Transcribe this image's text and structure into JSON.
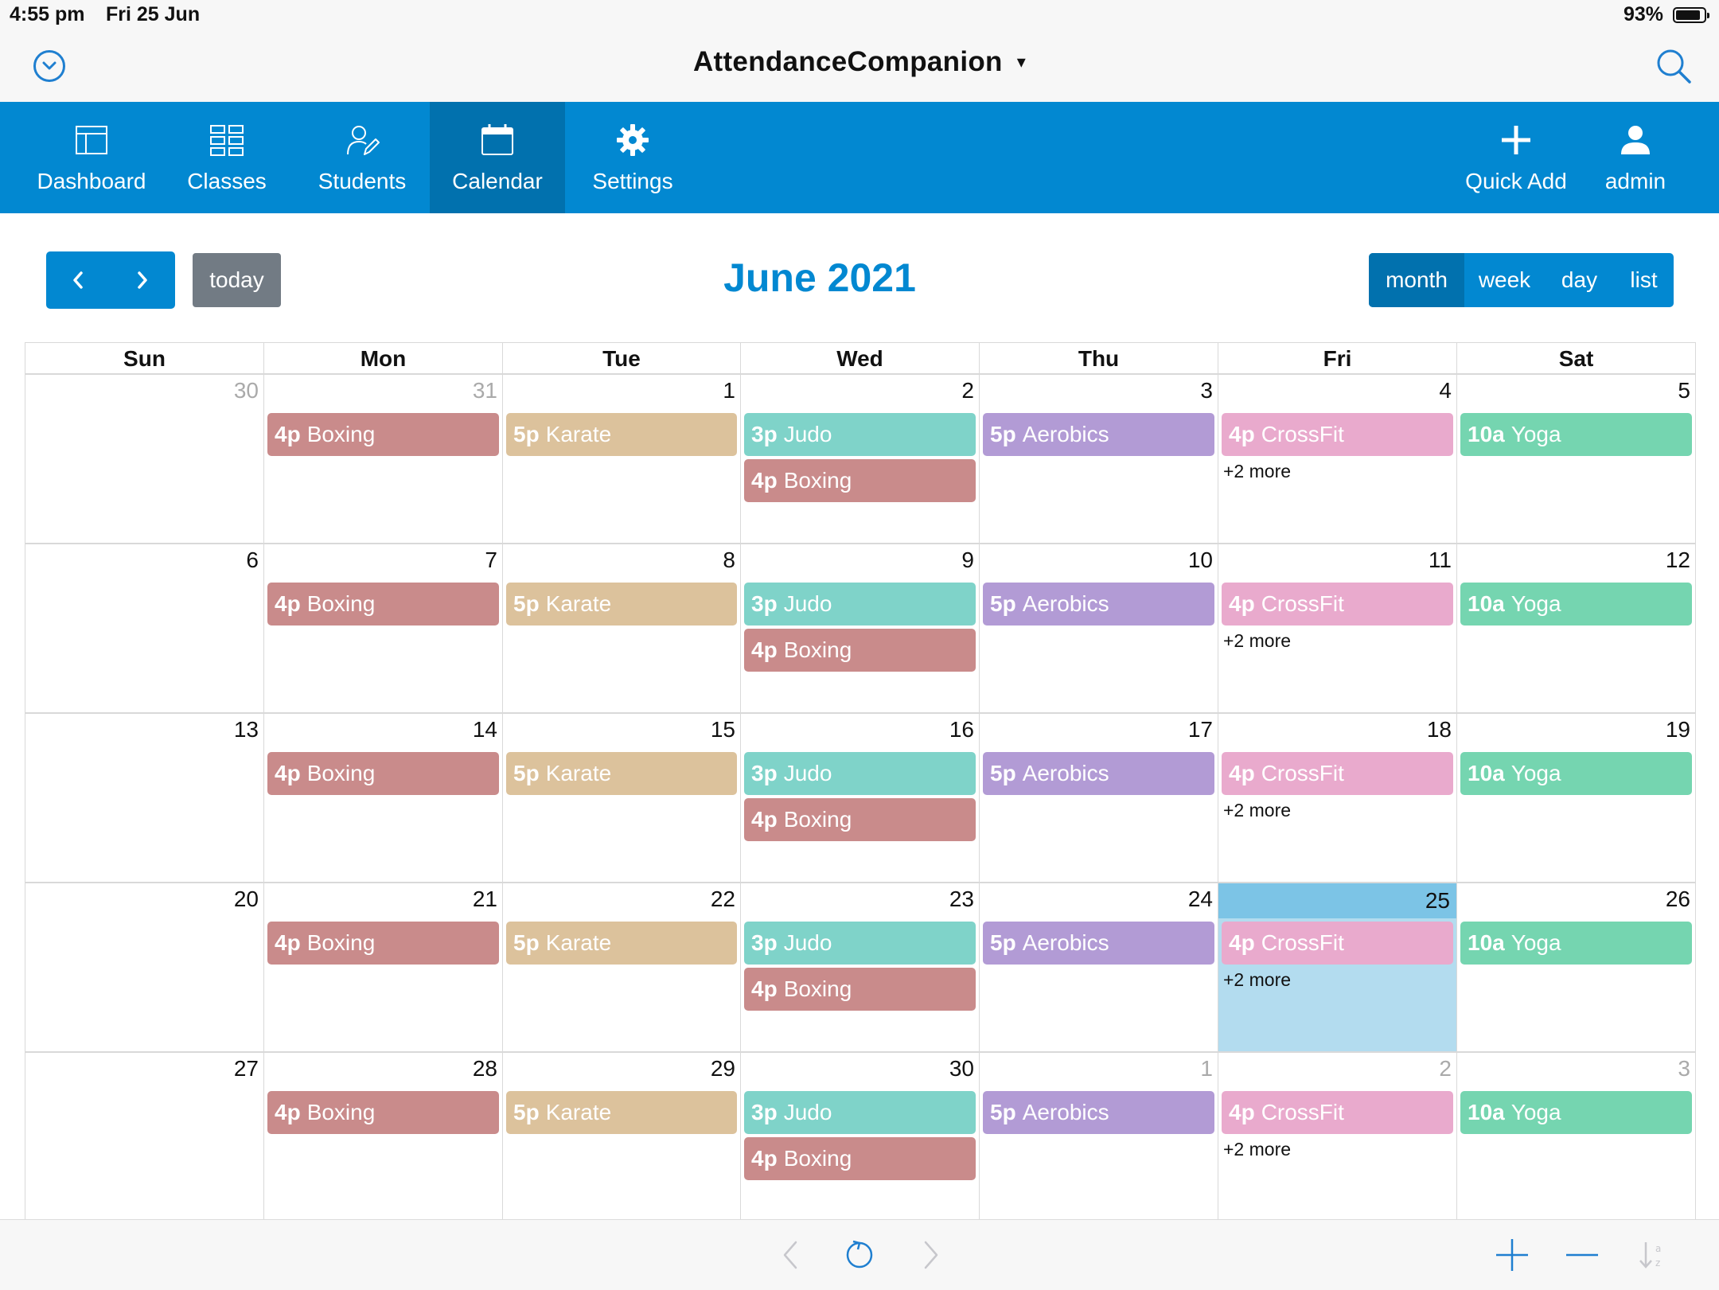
{
  "status_bar": {
    "time": "4:55 pm",
    "date": "Fri 25 Jun",
    "battery": "93%"
  },
  "app": {
    "title": "AttendanceCompanion",
    "title_caret": "▾"
  },
  "nav": {
    "items": [
      {
        "label": "Dashboard",
        "icon": "dashboard-icon"
      },
      {
        "label": "Classes",
        "icon": "grid-icon"
      },
      {
        "label": "Students",
        "icon": "user-edit-icon"
      },
      {
        "label": "Calendar",
        "icon": "calendar-icon"
      },
      {
        "label": "Settings",
        "icon": "gear-icon"
      }
    ],
    "active": "Calendar",
    "quick_add": "Quick Add",
    "user": "admin"
  },
  "toolbar": {
    "prev_icon": "chevron-left-icon",
    "next_icon": "chevron-right-icon",
    "today_label": "today",
    "month_title": "June 2021",
    "views": [
      "month",
      "week",
      "day",
      "list"
    ],
    "active_view": "month"
  },
  "colors": {
    "accent": "#0288d1",
    "accent_dark": "#0171ae",
    "Boxing": "#c98b8b",
    "Karate": "#dcc29c",
    "Judo": "#7fd3c9",
    "Aerobics": "#b29bd5",
    "CrossFit": "#e9aacd",
    "Yoga": "#75d5b0",
    "today_bg": "#b3dcef"
  },
  "calendar": {
    "weekdays": [
      "Sun",
      "Mon",
      "Tue",
      "Wed",
      "Thu",
      "Fri",
      "Sat"
    ],
    "weeks": [
      [
        {
          "day": "30",
          "other": true,
          "events": []
        },
        {
          "day": "31",
          "other": true,
          "events": [
            {
              "time": "4p",
              "title": "Boxing"
            }
          ]
        },
        {
          "day": "1",
          "events": [
            {
              "time": "5p",
              "title": "Karate"
            }
          ]
        },
        {
          "day": "2",
          "events": [
            {
              "time": "3p",
              "title": "Judo"
            },
            {
              "time": "4p",
              "title": "Boxing"
            }
          ]
        },
        {
          "day": "3",
          "events": [
            {
              "time": "5p",
              "title": "Aerobics"
            }
          ]
        },
        {
          "day": "4",
          "events": [
            {
              "time": "4p",
              "title": "CrossFit"
            }
          ],
          "more": "+2 more"
        },
        {
          "day": "5",
          "events": [
            {
              "time": "10a",
              "title": "Yoga"
            }
          ]
        }
      ],
      [
        {
          "day": "6",
          "events": []
        },
        {
          "day": "7",
          "events": [
            {
              "time": "4p",
              "title": "Boxing"
            }
          ]
        },
        {
          "day": "8",
          "events": [
            {
              "time": "5p",
              "title": "Karate"
            }
          ]
        },
        {
          "day": "9",
          "events": [
            {
              "time": "3p",
              "title": "Judo"
            },
            {
              "time": "4p",
              "title": "Boxing"
            }
          ]
        },
        {
          "day": "10",
          "events": [
            {
              "time": "5p",
              "title": "Aerobics"
            }
          ]
        },
        {
          "day": "11",
          "events": [
            {
              "time": "4p",
              "title": "CrossFit"
            }
          ],
          "more": "+2 more"
        },
        {
          "day": "12",
          "events": [
            {
              "time": "10a",
              "title": "Yoga"
            }
          ]
        }
      ],
      [
        {
          "day": "13",
          "events": []
        },
        {
          "day": "14",
          "events": [
            {
              "time": "4p",
              "title": "Boxing"
            }
          ]
        },
        {
          "day": "15",
          "events": [
            {
              "time": "5p",
              "title": "Karate"
            }
          ]
        },
        {
          "day": "16",
          "events": [
            {
              "time": "3p",
              "title": "Judo"
            },
            {
              "time": "4p",
              "title": "Boxing"
            }
          ]
        },
        {
          "day": "17",
          "events": [
            {
              "time": "5p",
              "title": "Aerobics"
            }
          ]
        },
        {
          "day": "18",
          "events": [
            {
              "time": "4p",
              "title": "CrossFit"
            }
          ],
          "more": "+2 more"
        },
        {
          "day": "19",
          "events": [
            {
              "time": "10a",
              "title": "Yoga"
            }
          ]
        }
      ],
      [
        {
          "day": "20",
          "events": []
        },
        {
          "day": "21",
          "events": [
            {
              "time": "4p",
              "title": "Boxing"
            }
          ]
        },
        {
          "day": "22",
          "events": [
            {
              "time": "5p",
              "title": "Karate"
            }
          ]
        },
        {
          "day": "23",
          "events": [
            {
              "time": "3p",
              "title": "Judo"
            },
            {
              "time": "4p",
              "title": "Boxing"
            }
          ]
        },
        {
          "day": "24",
          "events": [
            {
              "time": "5p",
              "title": "Aerobics"
            }
          ]
        },
        {
          "day": "25",
          "today": true,
          "events": [
            {
              "time": "4p",
              "title": "CrossFit"
            }
          ],
          "more": "+2 more"
        },
        {
          "day": "26",
          "events": [
            {
              "time": "10a",
              "title": "Yoga"
            }
          ]
        }
      ],
      [
        {
          "day": "27",
          "events": []
        },
        {
          "day": "28",
          "events": [
            {
              "time": "4p",
              "title": "Boxing"
            }
          ]
        },
        {
          "day": "29",
          "events": [
            {
              "time": "5p",
              "title": "Karate"
            }
          ]
        },
        {
          "day": "30",
          "events": [
            {
              "time": "3p",
              "title": "Judo"
            },
            {
              "time": "4p",
              "title": "Boxing"
            }
          ]
        },
        {
          "day": "1",
          "other": true,
          "events": [
            {
              "time": "5p",
              "title": "Aerobics"
            }
          ]
        },
        {
          "day": "2",
          "other": true,
          "events": [
            {
              "time": "4p",
              "title": "CrossFit"
            }
          ],
          "more": "+2 more"
        },
        {
          "day": "3",
          "other": true,
          "events": [
            {
              "time": "10a",
              "title": "Yoga"
            }
          ]
        }
      ]
    ]
  },
  "bottom_bar": {
    "icons": [
      "back-arrow-icon",
      "reload-icon",
      "forward-arrow-icon",
      "zoom-in-icon",
      "zoom-out-icon",
      "sort-icon"
    ]
  }
}
